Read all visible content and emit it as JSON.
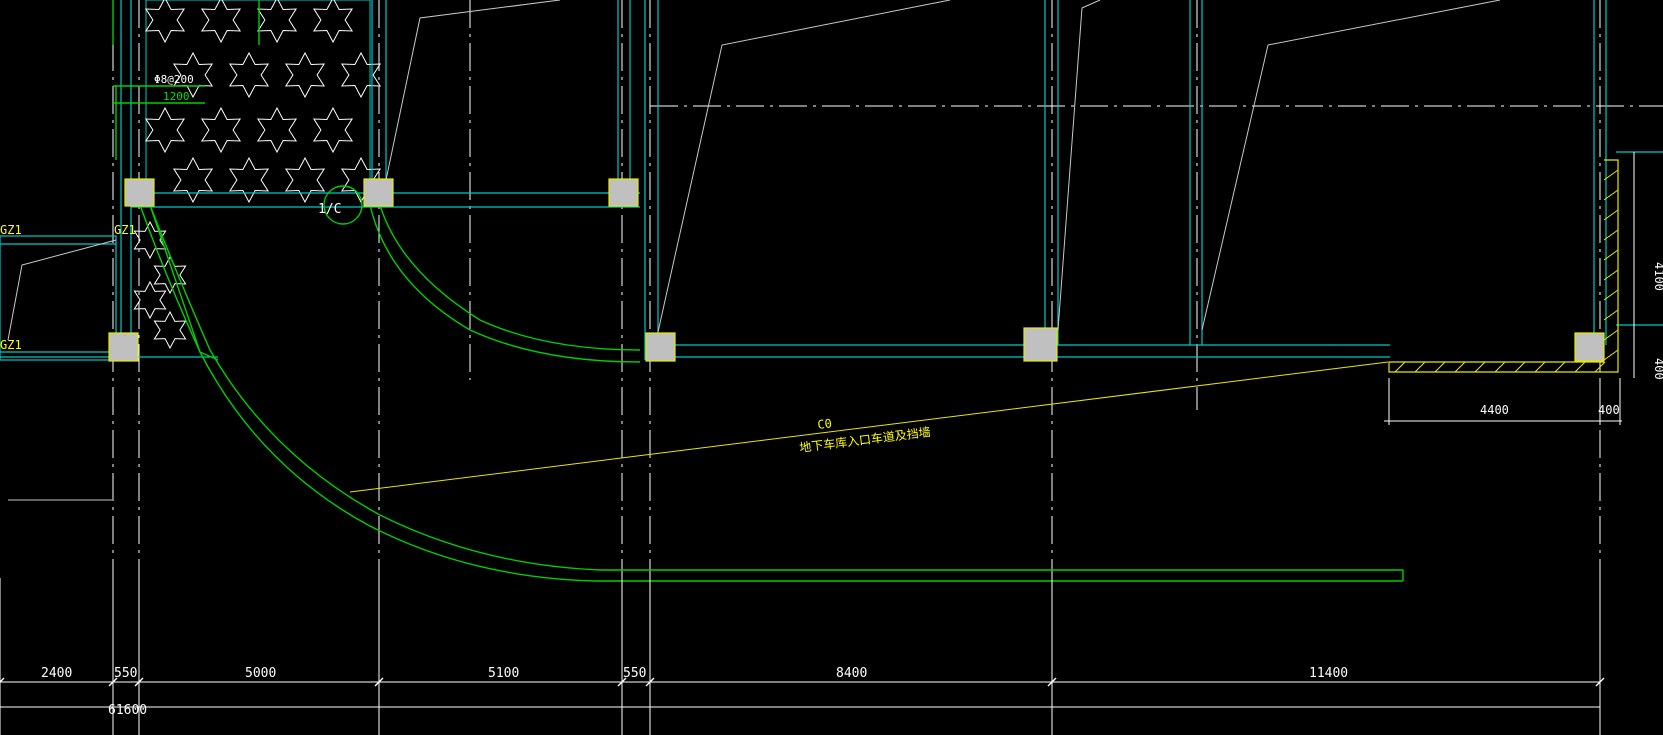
{
  "drawing": {
    "background": "#000000",
    "colors": {
      "axis": "#ffffff",
      "wall": "#00c8c8",
      "ramp": "#00d000",
      "column_fill": "#c0c0c0",
      "column_stroke": "#e8e800",
      "annotation": "#ffff00",
      "leader": "#c8c8c8"
    },
    "grid_marker": "1/C",
    "rebar_note": "Φ8@200",
    "rebar_spacing": "1200",
    "column_tags": [
      "GZ1",
      "GZ1",
      "GZ1"
    ],
    "ramp_code": "C0",
    "ramp_note": "地下车库入口车道及挡墙",
    "dimensions_bottom": [
      "2400",
      "550",
      "5000",
      "5100",
      "550",
      "8400",
      "11400"
    ],
    "dimension_total": "61600",
    "dimensions_right_vertical": [
      "4100",
      "400"
    ],
    "dimensions_right_horizontal": [
      "4400",
      "400"
    ]
  }
}
